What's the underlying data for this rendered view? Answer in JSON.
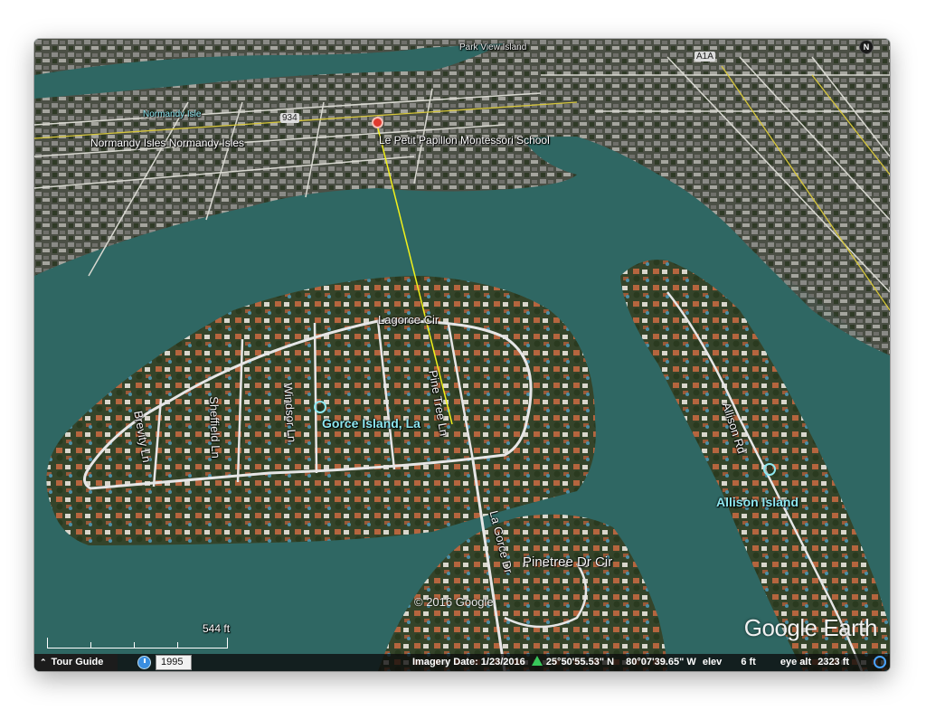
{
  "labels": {
    "normandy_isle": "Normandy Isle",
    "normandy_isles": "Normandy Isles  Normandy Isles",
    "school": "Le Petit Papillon Montessori School",
    "park_view": "Park View Island",
    "route_934": "934",
    "route_a1a": "A1A",
    "lagorce_cir": "Lagorce Cir",
    "sheffield": "Sheffield Ln",
    "windsor": "Windsor Ln",
    "pine_tree": "Pine Tree Ln",
    "brevity": "Brevity Ln",
    "gorce_island": "Gorce Island, La",
    "allison_rd": "Allison Rd",
    "allison_island": "Allison Island",
    "la_gorce_dr": "La Gorce Dr",
    "pinetree_dr": "Pinetree Dr Cir"
  },
  "map": {
    "copyright": "© 2016 Google",
    "logo": "Google Earth",
    "north_label": "N",
    "scale_label": "544 ft"
  },
  "statusbar": {
    "tour_guide": "Tour Guide",
    "year": "1995",
    "imagery_date": "Imagery Date: 1/23/2016",
    "lat": "25°50'55.53\" N",
    "lon": "80°07'39.65\" W",
    "elev_label": "elev",
    "elev_value": "6 ft",
    "eye_alt_label": "eye alt",
    "eye_alt_value": "2323 ft"
  },
  "colors": {
    "water": "#2f6763",
    "land": "#3b4a2c",
    "road": "#e6e6e6",
    "measure_line": "#f2f21a",
    "label_cyan": "#8ee8f0"
  },
  "icons": [
    "north-compass-icon",
    "clock-icon",
    "tour-caret-icon",
    "elevation-triangle-icon",
    "loading-icon"
  ]
}
